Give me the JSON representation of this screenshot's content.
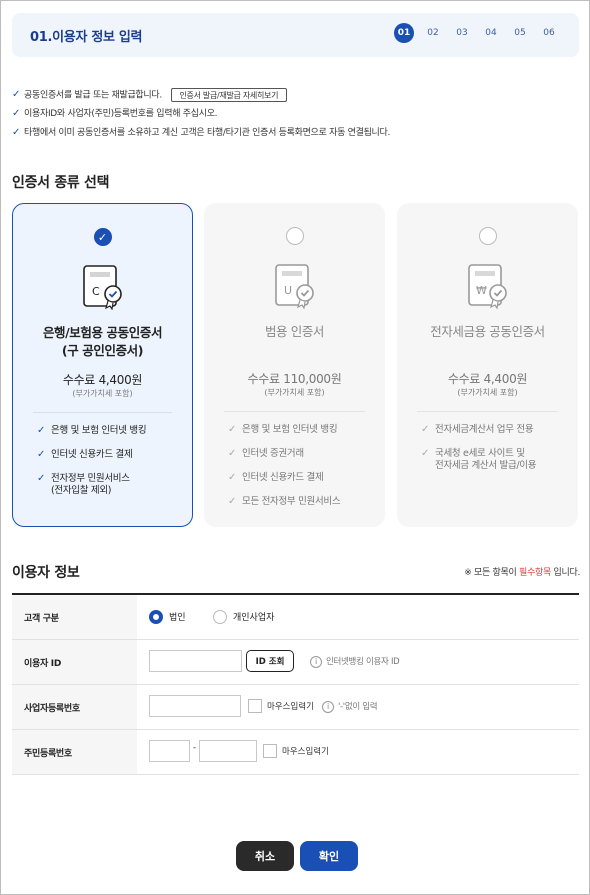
{
  "header": {
    "title": "01.이용자 정보 입력",
    "steps": [
      "01",
      "02",
      "03",
      "04",
      "05",
      "06"
    ],
    "active_step": "01"
  },
  "notes": [
    {
      "text": "공동인증서를 발급 또는 재발급합니다.",
      "button": "인증서 발급/재발급 자세히보기"
    },
    {
      "text": "이용자ID와 사업자(주민)등록번호를 입력해 주십시오."
    },
    {
      "text": "타행에서 이미 공동인증서를 소유하고 계신 고객은 타행/타기관 인증서 등록화면으로 자동 연결됩니다."
    }
  ],
  "cert_section": {
    "title": "인증서 종류 선택",
    "cards": [
      {
        "selected": true,
        "icon": "certificate-c-icon",
        "icon_letter": "C",
        "name_line1": "은행/보험용 공동인증서",
        "name_line2": "(구 공인인증서)",
        "fee": "수수료 4,400원",
        "vat": "(부가가치세 포함)",
        "features": [
          "은행 및 보험 인터넷 뱅킹",
          "인터넷 신용카드 결제",
          "전자정부 민원서비스\n(전자입찰 제외)"
        ]
      },
      {
        "selected": false,
        "icon": "certificate-u-icon",
        "icon_letter": "U",
        "name_line1": "범용 인증서",
        "name_line2": "",
        "fee": "수수료 110,000원",
        "vat": "(부가가치세 포함)",
        "features": [
          "은행 및 보험 인터넷 뱅킹",
          "인터넷 증권거래",
          "인터넷 신용카드 결제",
          "모든 전자정부 민원서비스"
        ]
      },
      {
        "selected": false,
        "icon": "certificate-won-icon",
        "icon_letter": "₩",
        "name_line1": "전자세금용 공동인증서",
        "name_line2": "",
        "fee": "수수료 4,400원",
        "vat": "(부가가치세 포함)",
        "features": [
          "전자세금계산서 업무 전용",
          "국세청 e세로 사이트 및\n전자세금 계산서 발급/이용"
        ]
      }
    ]
  },
  "user_section": {
    "title": "이용자 정보",
    "required_note_prefix": "※ 모든 항목이 ",
    "required_note_red": "필수항목",
    "required_note_suffix": " 입니다.",
    "customer_type": {
      "label": "고객 구분",
      "options": [
        "법인",
        "개인사업자"
      ],
      "selected": "법인"
    },
    "user_id": {
      "label": "이용자 ID",
      "value": "",
      "check_button": "ID 조회",
      "hint": "인터넷뱅킹 이용자 ID"
    },
    "biz_number": {
      "label": "사업자등록번호",
      "value": "",
      "mouse_input_label": "마우스입력기",
      "hint": "'-'없이 입력"
    },
    "resident_number": {
      "label": "주민등록번호",
      "front": "",
      "separator": "-",
      "back": "",
      "mouse_input_label": "마우스입력기"
    }
  },
  "buttons": {
    "cancel": "취소",
    "confirm": "확인"
  },
  "colors": {
    "primary": "#1a4fb5",
    "required_red": "#e03c3c",
    "dark_button": "#2a2a2a"
  }
}
